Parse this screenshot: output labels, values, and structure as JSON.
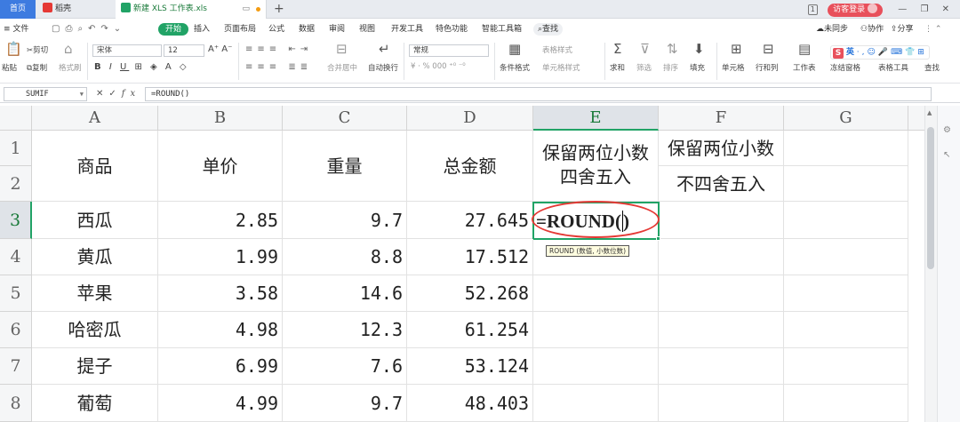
{
  "tabs": {
    "home": "首页",
    "doc": "稻壳",
    "active": "新建 XLS 工作表.xls",
    "new": "+"
  },
  "window": {
    "page_indicator": "1",
    "visitor_login": "访客登录",
    "min": "—",
    "restore": "❐",
    "close": "✕"
  },
  "menu": {
    "file": "≡ 文件",
    "start": "开始",
    "items": [
      "插入",
      "页面布局",
      "公式",
      "数据",
      "审阅",
      "视图",
      "开发工具",
      "特色功能",
      "智能工具箱"
    ],
    "search": "查找",
    "right": [
      "未同步",
      "协作",
      "分享"
    ]
  },
  "ribbon": {
    "paste": "粘贴",
    "cut": "剪切",
    "copy": "复制",
    "format_painter": "格式刷",
    "font_name": "宋体",
    "font_size": "12",
    "bold": "B",
    "italic": "I",
    "underline": "U",
    "merge_center": "合并居中",
    "wrap": "自动换行",
    "number_format": "常规",
    "currency": "¥ · % 000 ⁺⁰ ⁻⁰",
    "table_style": "表格样式",
    "cond_format": "条件格式",
    "cell_style": "单元格样式",
    "sum": "求和",
    "filter": "筛选",
    "sort": "排序",
    "fill": "填充",
    "cell": "单元格",
    "row_col": "行和列",
    "worksheet": "工作表",
    "freeze": "冻结窗格",
    "table_tools": "表格工具",
    "find": "查找"
  },
  "ime": {
    "label": "英"
  },
  "formula_bar": {
    "name_box": "SUMIF",
    "cancel": "✕",
    "confirm": "✓",
    "fx": "fx",
    "content": "=ROUND()"
  },
  "sheet": {
    "columns": [
      "A",
      "B",
      "C",
      "D",
      "E",
      "F",
      "G"
    ],
    "rows": [
      "1",
      "2",
      "3",
      "4",
      "5",
      "6",
      "7",
      "8"
    ],
    "header": {
      "a": "商品",
      "b": "单价",
      "c": "重量",
      "d": "总金额",
      "e_line1": "保留两位小数",
      "e_line2": "四舍五入",
      "f_line1": "保留两位小数",
      "f_line2": "不四舍五入"
    },
    "data": [
      {
        "name": "西瓜",
        "price": "2.85",
        "weight": "9.7",
        "total": "27.645"
      },
      {
        "name": "黄瓜",
        "price": "1.99",
        "weight": "8.8",
        "total": "17.512"
      },
      {
        "name": "苹果",
        "price": "3.58",
        "weight": "14.6",
        "total": "52.268"
      },
      {
        "name": "哈密瓜",
        "price": "4.98",
        "weight": "12.3",
        "total": "61.254"
      },
      {
        "name": "提子",
        "price": "6.99",
        "weight": "7.6",
        "total": "53.124"
      },
      {
        "name": "葡萄",
        "price": "4.99",
        "weight": "9.7",
        "total": "48.403"
      }
    ],
    "active_cell_formula": "=ROUND(",
    "active_cell_formula_close": ")",
    "func_hint": "ROUND (数值, 小数位数)"
  },
  "colors": {
    "accent": "#21a366",
    "highlight": "#e53935",
    "home_tab": "#3d7be0"
  }
}
